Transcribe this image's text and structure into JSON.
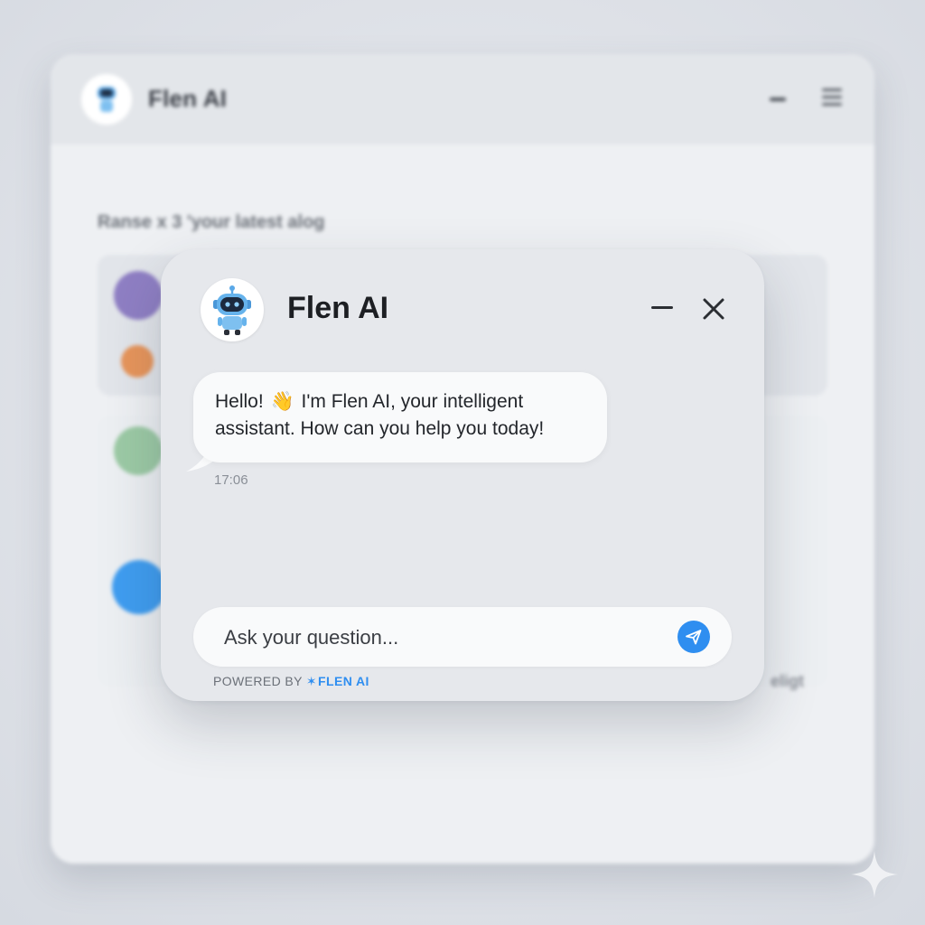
{
  "background": {
    "title": "Flen AI",
    "subtitle": "Ranse x 3 'your latest alog",
    "faint_text": "eligt"
  },
  "chat": {
    "title": "Flen AI",
    "message": {
      "text_before": "Hello!",
      "emoji": "👋",
      "text_after": "I'm Flen AI, your intelligent assistant. How can you help you today!",
      "time": "17:06"
    },
    "input": {
      "placeholder": "Ask your question..."
    },
    "footer": {
      "powered_by": "POWERED BY",
      "brand": "FLEN AI"
    }
  },
  "colors": {
    "accent": "#2f8ef0",
    "panel": "#e6e8ec",
    "bubble": "#f9fafb"
  },
  "icons": [
    "robot-avatar-icon",
    "minimize-icon",
    "close-icon",
    "send-icon",
    "spark-icon",
    "menu-icon"
  ]
}
